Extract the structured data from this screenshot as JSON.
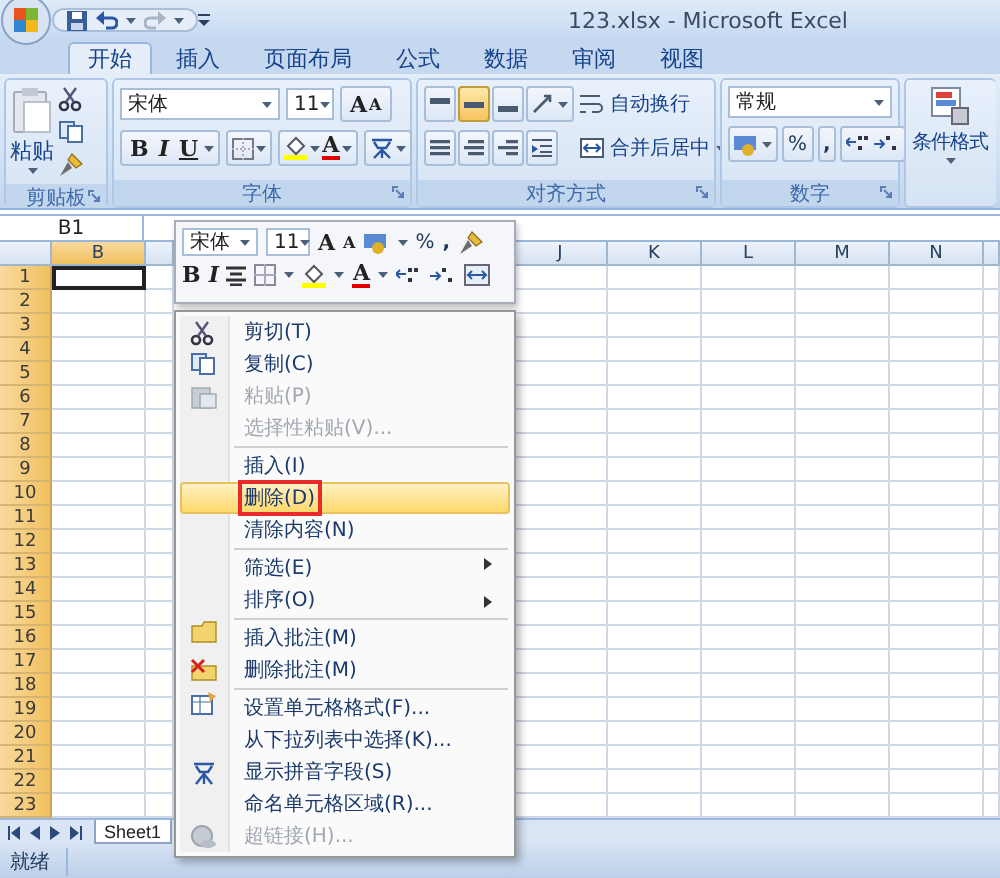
{
  "window": {
    "title": "123.xlsx - Microsoft Excel"
  },
  "tabs": [
    {
      "label": "开始",
      "selected": true
    },
    {
      "label": "插入",
      "selected": false
    },
    {
      "label": "页面布局",
      "selected": false
    },
    {
      "label": "公式",
      "selected": false
    },
    {
      "label": "数据",
      "selected": false
    },
    {
      "label": "审阅",
      "selected": false
    },
    {
      "label": "视图",
      "selected": false
    }
  ],
  "clipboard": {
    "label": "剪贴板",
    "paste": "粘贴"
  },
  "font": {
    "label": "字体",
    "name": "宋体",
    "size": "11",
    "grow": "A",
    "shrink": "A",
    "bold": "B",
    "italic": "I",
    "underline": "U",
    "font_color": "A"
  },
  "alignment": {
    "label": "对齐方式",
    "wrap": "自动换行",
    "merge": "合并后居中"
  },
  "number": {
    "label": "数字",
    "format": "常规",
    "percent": "%",
    "comma": ","
  },
  "styles": {
    "conditional_format": "条件格式"
  },
  "name_box": "B1",
  "mini_toolbar": {
    "font": "宋体",
    "size": "11",
    "grow": "A",
    "shrink": "A",
    "percent": "%",
    "comma": ",",
    "bold": "B",
    "italic": "I",
    "font_color": "A"
  },
  "columns": [
    {
      "label": "B",
      "selected": true
    },
    {
      "label": "J",
      "selected": false
    },
    {
      "label": "K",
      "selected": false
    },
    {
      "label": "L",
      "selected": false
    },
    {
      "label": "M",
      "selected": false
    },
    {
      "label": "N",
      "selected": false
    }
  ],
  "rows": [
    "1",
    "2",
    "3",
    "4",
    "5",
    "6",
    "7",
    "8",
    "9",
    "10",
    "11",
    "12",
    "13",
    "14",
    "15",
    "16",
    "17",
    "18",
    "19",
    "20",
    "21",
    "22",
    "23"
  ],
  "context_menu": [
    {
      "label": "剪切(T)",
      "disabled": false,
      "selected": false,
      "boxed": false,
      "submenu": false,
      "separator_before": false
    },
    {
      "label": "复制(C)",
      "disabled": false,
      "selected": false,
      "boxed": false,
      "submenu": false,
      "separator_before": false
    },
    {
      "label": "粘贴(P)",
      "disabled": true,
      "selected": false,
      "boxed": false,
      "submenu": false,
      "separator_before": false
    },
    {
      "label": "选择性粘贴(V)...",
      "disabled": true,
      "selected": false,
      "boxed": false,
      "submenu": false,
      "separator_before": false
    },
    {
      "label": "插入(I)",
      "disabled": false,
      "selected": false,
      "boxed": false,
      "submenu": false,
      "separator_before": true
    },
    {
      "label": "删除(D)",
      "disabled": false,
      "selected": true,
      "boxed": true,
      "submenu": false,
      "separator_before": false
    },
    {
      "label": "清除内容(N)",
      "disabled": false,
      "selected": false,
      "boxed": false,
      "submenu": false,
      "separator_before": false
    },
    {
      "label": "筛选(E)",
      "disabled": false,
      "selected": false,
      "boxed": false,
      "submenu": true,
      "separator_before": true
    },
    {
      "label": "排序(O)",
      "disabled": false,
      "selected": false,
      "boxed": false,
      "submenu": true,
      "separator_before": false
    },
    {
      "label": "插入批注(M)",
      "disabled": false,
      "selected": false,
      "boxed": false,
      "submenu": false,
      "separator_before": true
    },
    {
      "label": "删除批注(M)",
      "disabled": false,
      "selected": false,
      "boxed": false,
      "submenu": false,
      "separator_before": false
    },
    {
      "label": "设置单元格格式(F)...",
      "disabled": false,
      "selected": false,
      "boxed": false,
      "submenu": false,
      "separator_before": true
    },
    {
      "label": "从下拉列表中选择(K)...",
      "disabled": false,
      "selected": false,
      "boxed": false,
      "submenu": false,
      "separator_before": false
    },
    {
      "label": "显示拼音字段(S)",
      "disabled": false,
      "selected": false,
      "boxed": false,
      "submenu": false,
      "separator_before": false
    },
    {
      "label": "命名单元格区域(R)...",
      "disabled": false,
      "selected": false,
      "boxed": false,
      "submenu": false,
      "separator_before": false
    },
    {
      "label": "超链接(H)...",
      "disabled": true,
      "selected": false,
      "boxed": false,
      "submenu": false,
      "separator_before": false
    }
  ],
  "sheet_tabs": [
    {
      "label": "Sheet1",
      "selected": true
    }
  ],
  "status_bar": "就绪"
}
